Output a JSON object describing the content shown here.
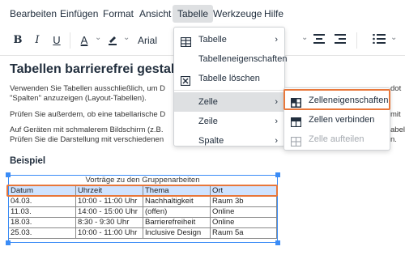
{
  "menubar": [
    {
      "label": "Bearbeiten",
      "active": false
    },
    {
      "label": "Einfügen",
      "active": false
    },
    {
      "label": "Format",
      "active": false
    },
    {
      "label": "Ansicht",
      "active": false
    },
    {
      "label": "Tabelle",
      "active": true
    },
    {
      "label": "Werkzeuge",
      "active": false
    },
    {
      "label": "Hilfe",
      "active": false
    }
  ],
  "toolbar": {
    "bold": "B",
    "italic": "I",
    "underline": "U",
    "font_color": "A",
    "font_family": "Arial",
    "icons": [
      "bold-icon",
      "italic-icon",
      "underline-icon",
      "font-color-icon",
      "highlight-icon",
      "align-center-icon",
      "align-right-icon",
      "list-icon"
    ]
  },
  "document": {
    "heading": "Tabellen barrierefrei gestalte",
    "para1_line1": "Verwenden Sie Tabellen ausschließlich, um D",
    "para1_line2": "\"Spalten\" anzuzeigen (Layout-Tabellen).",
    "para1_right": "dot",
    "para2_line1": "Prüfen Sie außerdem, ob eine tabellarische D",
    "para2_right": "mit",
    "para3_line1": "Auf Geräten mit schmalerem Bildschirm (z.B.",
    "para3_line2": "Prüfen Sie die Darstellung mit verschiedenen",
    "para3_right1": "abel",
    "para3_right2": "n.",
    "subheading": "Beispiel",
    "table": {
      "caption": "Vorträge zu den Gruppenarbeiten",
      "headers": [
        "Datum",
        "Uhrzeit",
        "Thema",
        "Ort"
      ],
      "rows": [
        [
          "04.03.",
          "10:00 - 11:00 Uhr",
          "Nachhaltigkeit",
          "Raum 3b"
        ],
        [
          "11.03.",
          "14:00 - 15:00 Uhr",
          "(offen)",
          "Online"
        ],
        [
          "18.03.",
          "8:30 - 9:30 Uhr",
          "Barrierefreiheit",
          "Online"
        ],
        [
          "25.03.",
          "10:00 - 11:00 Uhr",
          "Inclusive Design",
          "Raum 5a"
        ]
      ]
    }
  },
  "table_menu": {
    "items": [
      {
        "label": "Tabelle",
        "icon": "table-icon",
        "submenu": true
      },
      {
        "label": "Tabelleneigenschaften",
        "icon": "",
        "submenu": false
      },
      {
        "label": "Tabelle löschen",
        "icon": "delete-table-icon",
        "submenu": false
      },
      {
        "label": "Zelle",
        "icon": "",
        "submenu": true,
        "hover": true
      },
      {
        "label": "Zeile",
        "icon": "",
        "submenu": true
      },
      {
        "label": "Spalte",
        "icon": "",
        "submenu": true
      }
    ]
  },
  "cell_submenu": {
    "items": [
      {
        "label": "Zelleneigenschaften",
        "icon": "cell-properties-icon",
        "highlighted": true
      },
      {
        "label": "Zellen verbinden",
        "icon": "merge-cells-icon",
        "disabled": false
      },
      {
        "label": "Zelle aufteilen",
        "icon": "split-cell-icon",
        "disabled": true
      }
    ]
  },
  "colors": {
    "accent_orange": "#e8773a",
    "selection_blue": "#3b8cf6",
    "header_row_bg": "#cfe3ff",
    "menu_hover": "#dee0e2"
  }
}
